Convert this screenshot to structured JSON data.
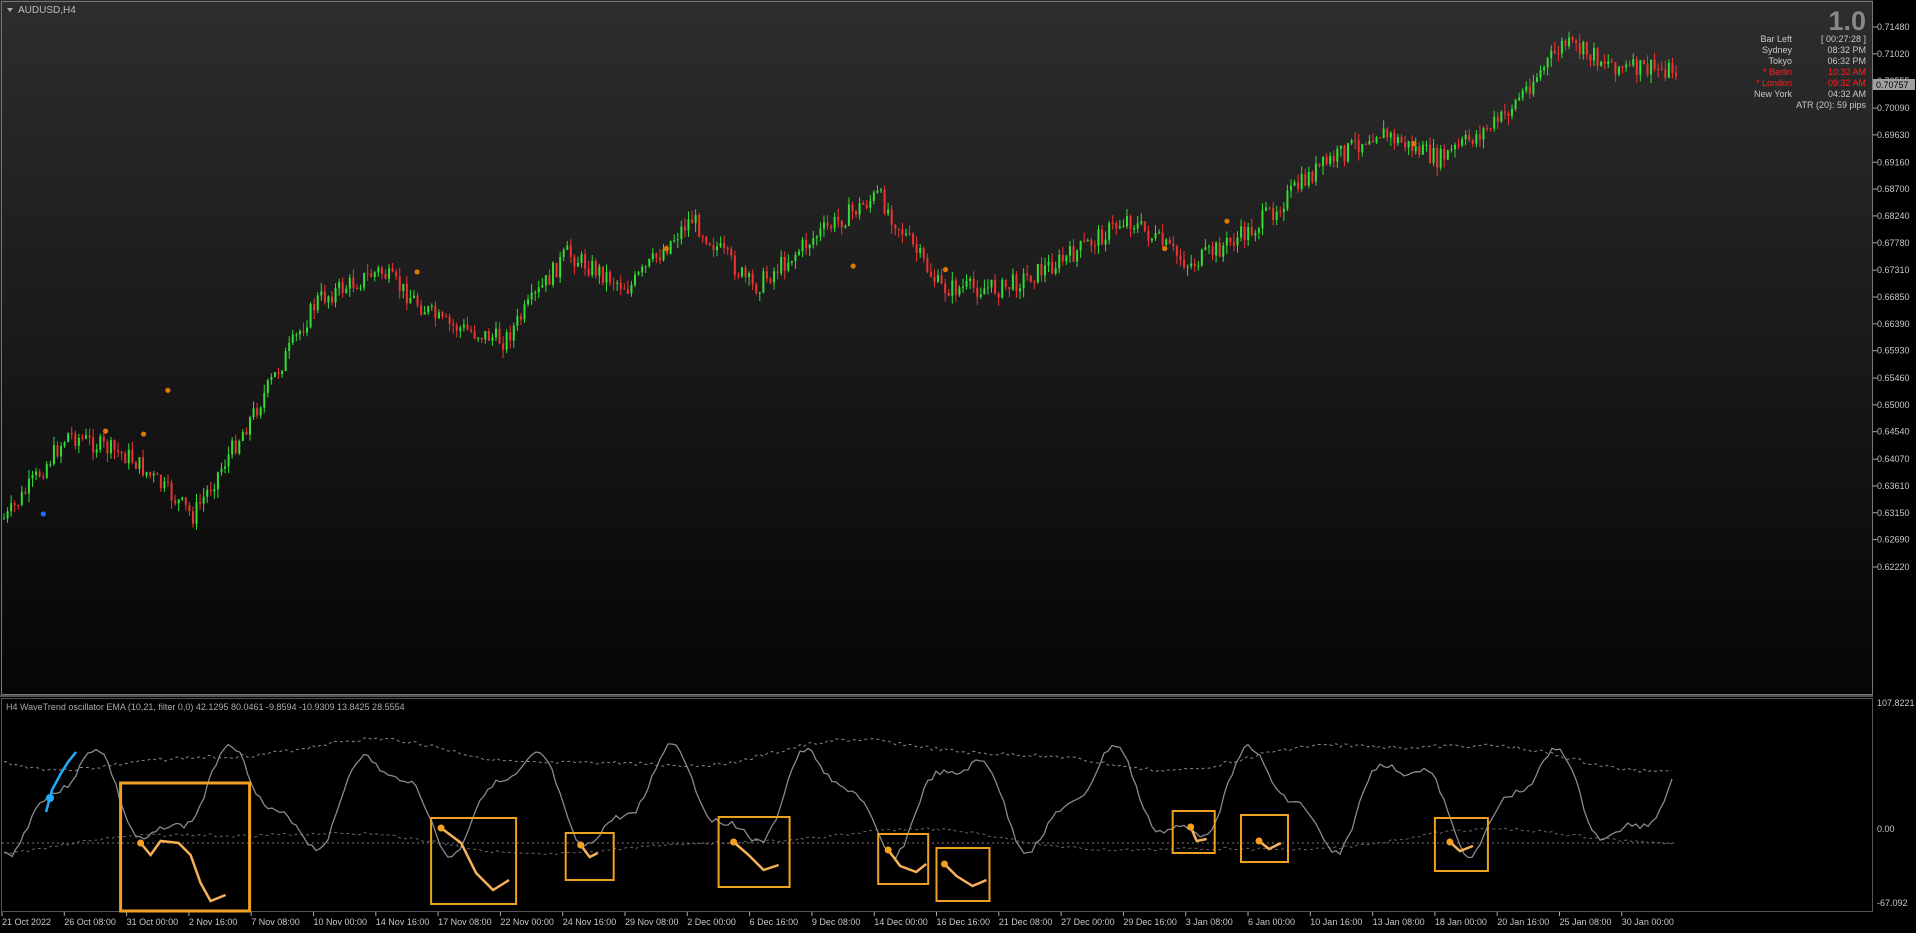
{
  "window": {
    "symbol_title": "AUDUSD,H4",
    "corner_value": "1.0"
  },
  "info_panel": {
    "rows": [
      {
        "label": "Bar Left",
        "value": "[ 00:27:28 ]",
        "highlight": false
      },
      {
        "label": "Sydney",
        "value": "08:32 PM",
        "highlight": false
      },
      {
        "label": "Tokyo",
        "value": "06:32 PM",
        "highlight": false
      },
      {
        "label": "* Berlin",
        "value": "10:32 AM",
        "highlight": true
      },
      {
        "label": "* London",
        "value": "09:32 AM",
        "highlight": true
      },
      {
        "label": "New York",
        "value": "04:32 AM",
        "highlight": false
      }
    ],
    "atr_text": "ATR (20): 59 pips"
  },
  "price_axis": {
    "labels": [
      "0.71480",
      "0.71020",
      "0.70555",
      "0.70090",
      "0.69630",
      "0.69160",
      "0.68700",
      "0.68240",
      "0.67780",
      "0.67310",
      "0.66850",
      "0.66390",
      "0.65930",
      "0.65460",
      "0.65000",
      "0.64540",
      "0.64070",
      "0.63610",
      "0.63150",
      "0.62690",
      "0.62220"
    ],
    "current_price": "0.70757"
  },
  "oscillator": {
    "title": "H4 WaveTrend oscillator EMA (10,21, filter 0,0) 42.1295 80.0461 -9.8594 -10.9309 13.8425 28.5554",
    "axis_labels": [
      "107.8221",
      "0.00",
      "-67.092"
    ]
  },
  "time_axis": {
    "labels": [
      "21 Oct 2022",
      "26 Oct 08:00",
      "31 Oct 00:00",
      "2 Nov 16:00",
      "7 Nov 08:00",
      "10 Nov 00:00",
      "14 Nov 16:00",
      "17 Nov 08:00",
      "22 Nov 00:00",
      "24 Nov 16:00",
      "29 Nov 08:00",
      "2 Dec 00:00",
      "6 Dec 16:00",
      "9 Dec 08:00",
      "14 Dec 00:00",
      "16 Dec 16:00",
      "21 Dec 08:00",
      "27 Dec 00:00",
      "29 Dec 16:00",
      "3 Jan 08:00",
      "6 Jan 00:00",
      "10 Jan 16:00",
      "13 Jan 08:00",
      "18 Jan 00:00",
      "20 Jan 16:00",
      "25 Jan 08:00",
      "30 Jan 00:00"
    ]
  },
  "colors": {
    "bull_candle": "#33dd33",
    "bear_candle": "#ee3333",
    "signal_dot": "#e07800",
    "highlight_box": "#f0a020",
    "wavetrend_up": "#22aaff",
    "text_red": "#ff2020"
  },
  "chart_data": {
    "type": "candlestick",
    "symbol": "AUDUSD",
    "timeframe": "H4",
    "close_path": [
      {
        "t": "21 Oct 2022",
        "price": 0.6305
      },
      {
        "t": "26 Oct 08:00",
        "price": 0.645
      },
      {
        "t": "31 Oct 00:00",
        "price": 0.641
      },
      {
        "t": "2 Nov 16:00",
        "price": 0.631
      },
      {
        "t": "7 Nov 08:00",
        "price": 0.649
      },
      {
        "t": "10 Nov 00:00",
        "price": 0.668
      },
      {
        "t": "14 Nov 16:00",
        "price": 0.673
      },
      {
        "t": "17 Nov 08:00",
        "price": 0.664
      },
      {
        "t": "22 Nov 00:00",
        "price": 0.661
      },
      {
        "t": "24 Nov 16:00",
        "price": 0.676
      },
      {
        "t": "29 Nov 08:00",
        "price": 0.67
      },
      {
        "t": "2 Dec 00:00",
        "price": 0.682
      },
      {
        "t": "6 Dec 16:00",
        "price": 0.67
      },
      {
        "t": "9 Dec 08:00",
        "price": 0.679
      },
      {
        "t": "14 Dec 00:00",
        "price": 0.686
      },
      {
        "t": "16 Dec 16:00",
        "price": 0.67
      },
      {
        "t": "21 Dec 08:00",
        "price": 0.67
      },
      {
        "t": "27 Dec 00:00",
        "price": 0.675
      },
      {
        "t": "29 Dec 16:00",
        "price": 0.682
      },
      {
        "t": "3 Jan 08:00",
        "price": 0.674
      },
      {
        "t": "6 Jan 00:00",
        "price": 0.68
      },
      {
        "t": "10 Jan 16:00",
        "price": 0.69
      },
      {
        "t": "13 Jan 08:00",
        "price": 0.697
      },
      {
        "t": "18 Jan 00:00",
        "price": 0.692
      },
      {
        "t": "20 Jan 16:00",
        "price": 0.699
      },
      {
        "t": "25 Jan 08:00",
        "price": 0.712
      },
      {
        "t": "30 Jan 00:00",
        "price": 0.7076
      }
    ],
    "signal_dots": [
      {
        "t": "26 Oct 08:00",
        "price": 0.6313,
        "color": "blue"
      },
      {
        "t": "31 Oct 00:00",
        "price": 0.6455,
        "color": "orange"
      },
      {
        "t": "31 Oct 00:00",
        "price": 0.645,
        "color": "orange"
      },
      {
        "t": "2 Nov 16:00",
        "price": 0.6525,
        "color": "orange"
      },
      {
        "t": "17 Nov 08:00",
        "price": 0.6728,
        "color": "orange"
      },
      {
        "t": "2 Dec 00:00",
        "price": 0.6768,
        "color": "orange"
      },
      {
        "t": "14 Dec 00:00",
        "price": 0.6738,
        "color": "orange"
      },
      {
        "t": "16 Dec 16:00",
        "price": 0.6732,
        "color": "orange"
      },
      {
        "t": "3 Jan 08:00",
        "price": 0.6768,
        "color": "orange"
      },
      {
        "t": "6 Jan 00:00",
        "price": 0.6815,
        "color": "orange"
      },
      {
        "t": "18 Jan 00:00",
        "price": 0.6948,
        "color": "orange"
      }
    ],
    "oscillator_series": [
      {
        "name": "WaveTrend",
        "range": [
          -67.092,
          107.8221
        ]
      }
    ]
  }
}
